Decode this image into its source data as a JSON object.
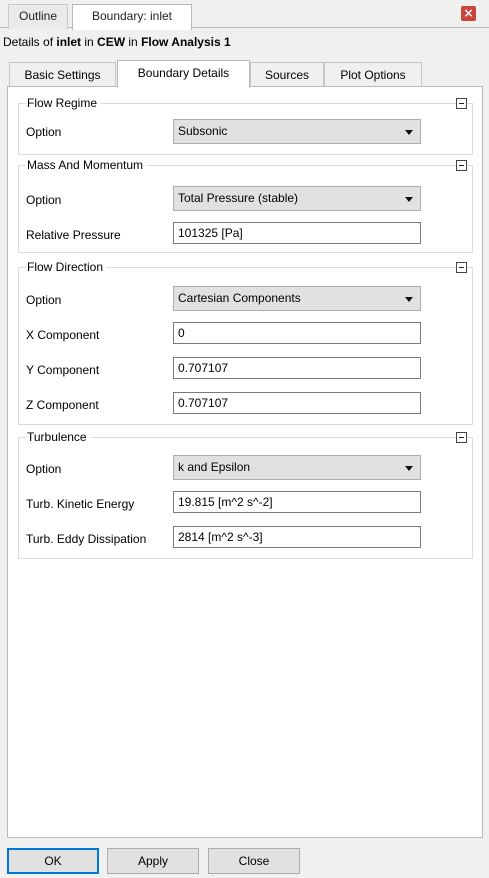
{
  "top_tabs": {
    "outline": "Outline",
    "boundary": "Boundary: inlet"
  },
  "details": {
    "prefix": "Details of ",
    "object": "inlet",
    "in1": " in ",
    "domain": "CEW",
    "in2": " in ",
    "analysis": "Flow Analysis 1"
  },
  "tabs": {
    "basic": "Basic Settings",
    "boundary": "Boundary Details",
    "sources": "Sources",
    "plot": "Plot Options"
  },
  "flow_regime": {
    "title": "Flow Regime",
    "option_label": "Option",
    "option_value": "Subsonic"
  },
  "mass_momentum": {
    "title": "Mass And Momentum",
    "option_label": "Option",
    "option_value": "Total Pressure (stable)",
    "pressure_label": "Relative Pressure",
    "pressure_value": "101325 [Pa]"
  },
  "flow_direction": {
    "title": "Flow Direction",
    "option_label": "Option",
    "option_value": "Cartesian Components",
    "x_label": "X Component",
    "x_value": "0",
    "y_label": "Y Component",
    "y_value": "0.707107",
    "z_label": "Z Component",
    "z_value": "0.707107"
  },
  "turbulence": {
    "title": "Turbulence",
    "option_label": "Option",
    "option_value": "k and Epsilon",
    "ke_label": "Turb. Kinetic Energy",
    "ke_value": "19.815 [m^2 s^-2]",
    "ed_label": "Turb. Eddy Dissipation",
    "ed_value": "2814 [m^2 s^-3]"
  },
  "buttons": {
    "ok": "OK",
    "apply": "Apply",
    "close": "Close"
  },
  "colors": {
    "accent": "#0078d7",
    "close_icon": "#c9463d"
  }
}
